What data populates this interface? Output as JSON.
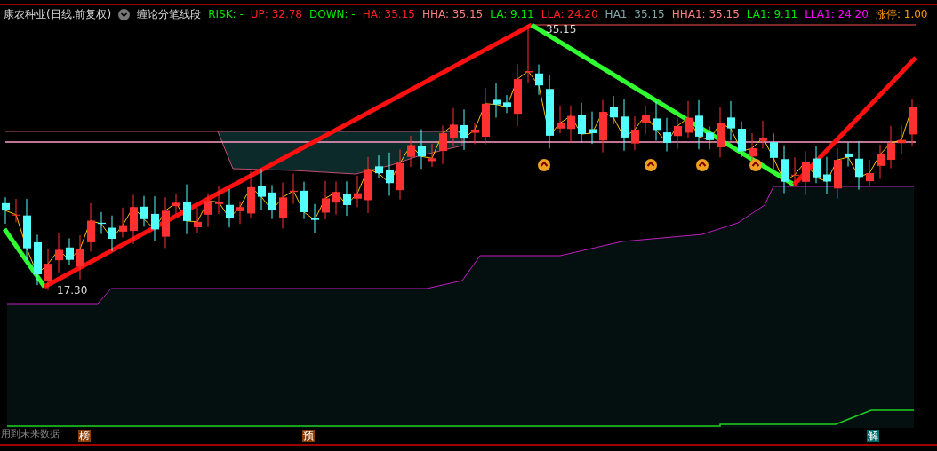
{
  "header": {
    "title": "康农种业(日线.前复权)",
    "indicator": "缠论分笔线段",
    "values": [
      {
        "text": "RISK: -",
        "color": "#00e600"
      },
      {
        "text": "UP: 32.78",
        "color": "#ff2020"
      },
      {
        "text": "DOWN: -",
        "color": "#00e600"
      },
      {
        "text": "HA: 35.15",
        "color": "#ff2020"
      },
      {
        "text": "HHA: 35.15",
        "color": "#ff8080"
      },
      {
        "text": "LA: 9.11",
        "color": "#00e600"
      },
      {
        "text": "LLA: 24.20",
        "color": "#ff2020"
      },
      {
        "text": "HA1: 35.15",
        "color": "#7fa8a8"
      },
      {
        "text": "HHA1: 35.15",
        "color": "#ff8080"
      },
      {
        "text": "LA1: 9.11",
        "color": "#00e600"
      },
      {
        "text": "LLA1: 24.20",
        "color": "#ff00ff"
      },
      {
        "text": "涨停: 1.00",
        "color": "#ff9900"
      }
    ]
  },
  "chart": {
    "high_label": "35.15",
    "low_label": "17.30",
    "note": "用到未来数据"
  },
  "markers": [
    {
      "text": "榜",
      "color": "#8b3a00"
    },
    {
      "text": "预",
      "color": "#8b3a00"
    },
    {
      "text": "解",
      "color": "#006b6b"
    }
  ]
}
